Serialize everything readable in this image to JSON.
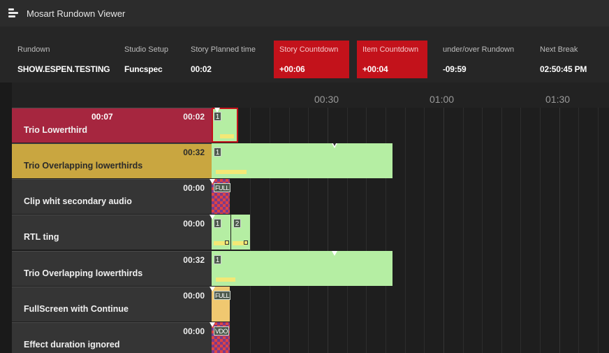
{
  "window": {
    "title": "Mosart Rundown Viewer",
    "icon": "rundown-list-icon"
  },
  "info": [
    {
      "label": "Rundown",
      "value": "SHOW.ESPEN.TESTING",
      "highlight": false
    },
    {
      "label": "Studio Setup",
      "value": "Funcspec",
      "highlight": false
    },
    {
      "label": "Story Planned time",
      "value": "00:02",
      "highlight": false
    },
    {
      "label": "Story Countdown",
      "value": "+00:06",
      "highlight": true
    },
    {
      "label": "Item Countdown",
      "value": "+00:04",
      "highlight": true
    },
    {
      "label": "under/over Rundown",
      "value": "-09:59",
      "highlight": false
    },
    {
      "label": "Next Break",
      "value": "02:50:45 PM",
      "highlight": false
    }
  ],
  "timeline": {
    "ticks": [
      "00:30",
      "01:00",
      "01:30"
    ]
  },
  "stories": [
    {
      "name": "Trio Lowerthird",
      "duration": "00:02",
      "elapsed": "00:07",
      "state": "on-air",
      "items": [
        {
          "label": "1",
          "kind": "graphic"
        }
      ]
    },
    {
      "name": "Trio Overlapping lowerthirds",
      "duration": "00:32",
      "elapsed": "",
      "state": "next",
      "items": [
        {
          "label": "1",
          "kind": "graphic"
        }
      ]
    },
    {
      "name": "Clip whit secondary audio",
      "duration": "00:00",
      "elapsed": "",
      "state": "normal",
      "items": [
        {
          "label": "FULL",
          "kind": "clip"
        }
      ]
    },
    {
      "name": "RTL ting",
      "duration": "00:00",
      "elapsed": "",
      "state": "normal",
      "items": [
        {
          "label": "1",
          "kind": "graphic"
        },
        {
          "label": "2",
          "kind": "graphic"
        }
      ]
    },
    {
      "name": "Trio Overlapping lowerthirds",
      "duration": "00:32",
      "elapsed": "",
      "state": "normal",
      "items": [
        {
          "label": "1",
          "kind": "graphic"
        }
      ]
    },
    {
      "name": "FullScreen with Continue",
      "duration": "00:00",
      "elapsed": "",
      "state": "normal",
      "items": [
        {
          "label": "FULL",
          "kind": "fullscreen"
        }
      ]
    },
    {
      "name": "Effect duration ignored",
      "duration": "00:00",
      "elapsed": "",
      "state": "normal",
      "items": [
        {
          "label": "VDO",
          "kind": "clip"
        }
      ]
    }
  ],
  "colors": {
    "on_air": "#a6263f",
    "next": "#c9a640",
    "countdown": "#c3121b",
    "graphic_item": "#b5eea3",
    "fullscreen_item": "#f0c870"
  }
}
